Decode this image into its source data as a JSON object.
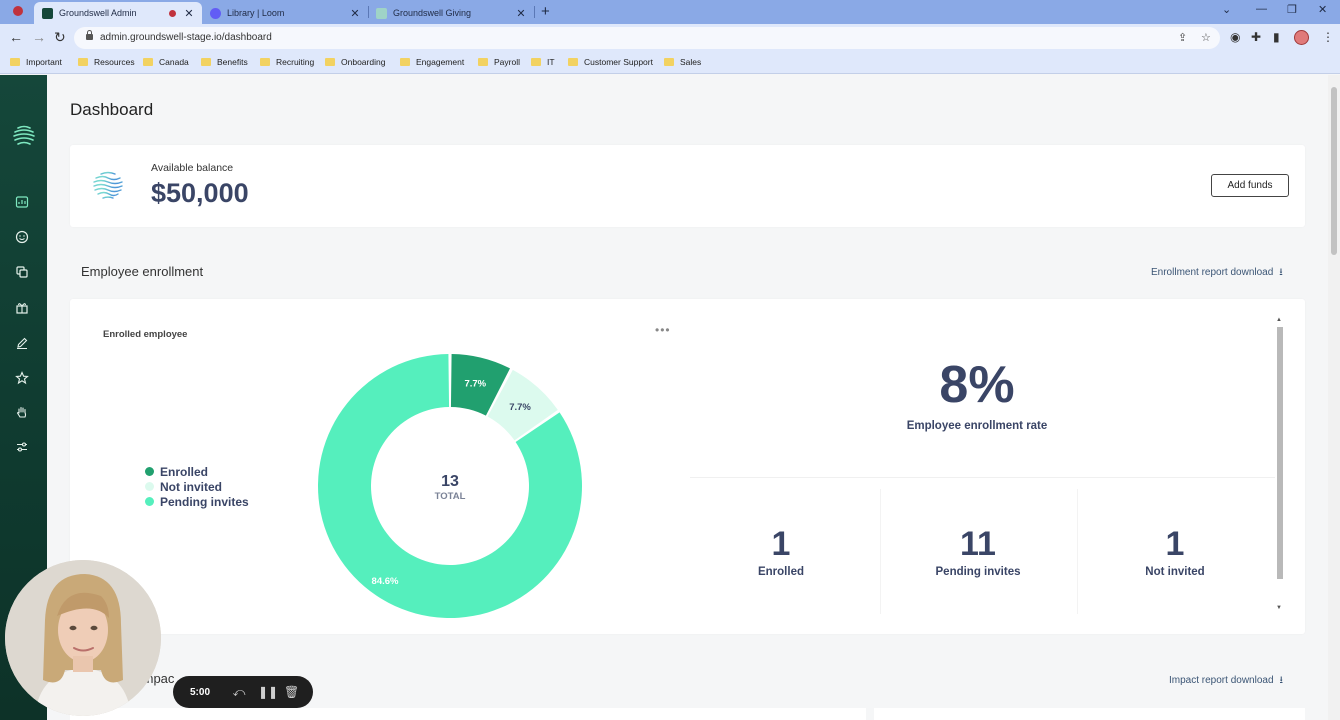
{
  "browser": {
    "tabs": [
      {
        "label": "Groundswell Admin",
        "active": true,
        "favicon_color": "#15473a"
      },
      {
        "label": "Library | Loom",
        "active": false,
        "favicon_color": "#625df5"
      },
      {
        "label": "Groundswell Giving",
        "active": false,
        "favicon_color": "#9fd3c7"
      }
    ],
    "url": "admin.groundswell-stage.io/dashboard",
    "bookmarks": [
      "Important",
      "Resources",
      "Canada",
      "Benefits",
      "Recruiting",
      "Onboarding",
      "Engagement",
      "Payroll",
      "IT",
      "Customer Support",
      "Sales"
    ]
  },
  "sidebar": {
    "items": [
      {
        "icon": "chart-icon"
      },
      {
        "icon": "smiley-icon"
      },
      {
        "icon": "copy-icon"
      },
      {
        "icon": "gift-icon"
      },
      {
        "icon": "pencil-icon"
      },
      {
        "icon": "star-icon"
      },
      {
        "icon": "hand-icon"
      },
      {
        "icon": "sliders-icon"
      }
    ]
  },
  "page": {
    "title": "Dashboard"
  },
  "balance": {
    "label": "Available balance",
    "value": "$50,000",
    "add_funds_label": "Add funds"
  },
  "enrollment": {
    "section_title": "Employee enrollment",
    "report_link": "Enrollment report download",
    "chart_title": "Enrolled employee",
    "rate_value": "8%",
    "rate_label": "Employee enrollment rate",
    "stats": [
      {
        "value": "1",
        "label": "Enrolled"
      },
      {
        "value": "11",
        "label": "Pending invites"
      },
      {
        "value": "1",
        "label": "Not invited"
      }
    ]
  },
  "impact": {
    "section_title": "Impac",
    "report_link": "Impact report download"
  },
  "chart_data": {
    "type": "pie",
    "donut": true,
    "categories": [
      "Enrolled",
      "Not invited",
      "Pending invites"
    ],
    "values": [
      7.7,
      7.7,
      84.6
    ],
    "data_labels": [
      "7.7%",
      "7.7%",
      "84.6%"
    ],
    "colors": [
      "#21a06f",
      "#dcfaee",
      "#55efbd"
    ],
    "center_value": "13",
    "center_label": "TOTAL",
    "legend": "left"
  },
  "recorder": {
    "time": "5:00"
  },
  "colors": {
    "sidebar": "#15473a",
    "heading_navy": "#3a4566",
    "link": "#3b5575"
  }
}
